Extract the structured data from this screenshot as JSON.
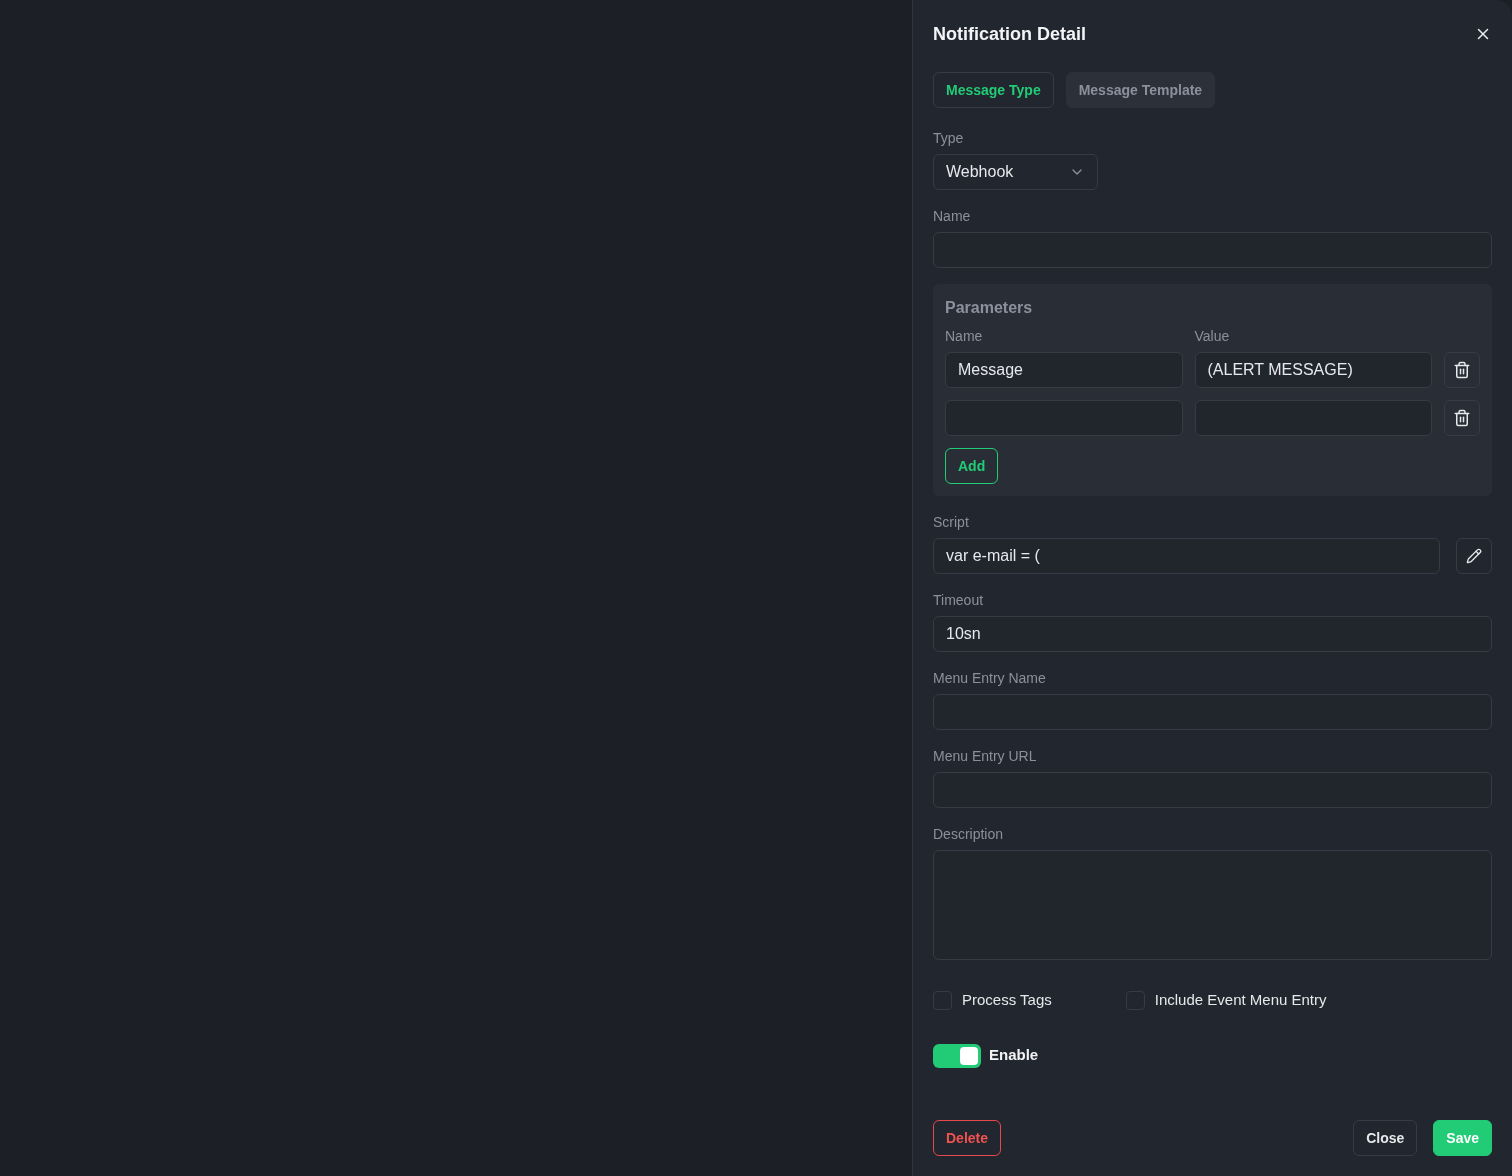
{
  "dialog": {
    "title": "Notification Detail"
  },
  "tabs": [
    {
      "label": "Message Type",
      "selected": true
    },
    {
      "label": "Message Template",
      "selected": false
    }
  ],
  "type_field": {
    "label": "Type",
    "value": "Webhook"
  },
  "name_field": {
    "label": "Name"
  },
  "parameters": {
    "title": "Parameters",
    "name_header": "Name",
    "value_header": "Value",
    "rows": [
      {
        "name": "Message",
        "value": "(ALERT MESSAGE)"
      },
      {}
    ],
    "add_button": "Add"
  },
  "fields": [
    {
      "kind": "script",
      "label": "Script",
      "value": "var e-mail = ("
    },
    {
      "kind": "text",
      "label": "Timeout",
      "value": "10sn"
    },
    {
      "kind": "text",
      "label": "Menu Entry Name"
    },
    {
      "kind": "text",
      "label": "Menu Entry URL"
    },
    {
      "kind": "textarea",
      "label": "Description"
    }
  ],
  "checkboxes": [
    {
      "label": "Process Tags",
      "checked": false
    },
    {
      "label": "Include Event Menu Entry",
      "checked": false
    }
  ],
  "toggle": {
    "label": "Enable",
    "on": true
  },
  "buttons": [
    {
      "kind": "danger",
      "label": "Delete"
    },
    {
      "kind": "secondary",
      "label": "Close"
    },
    {
      "kind": "primary",
      "label": "Save"
    }
  ]
}
